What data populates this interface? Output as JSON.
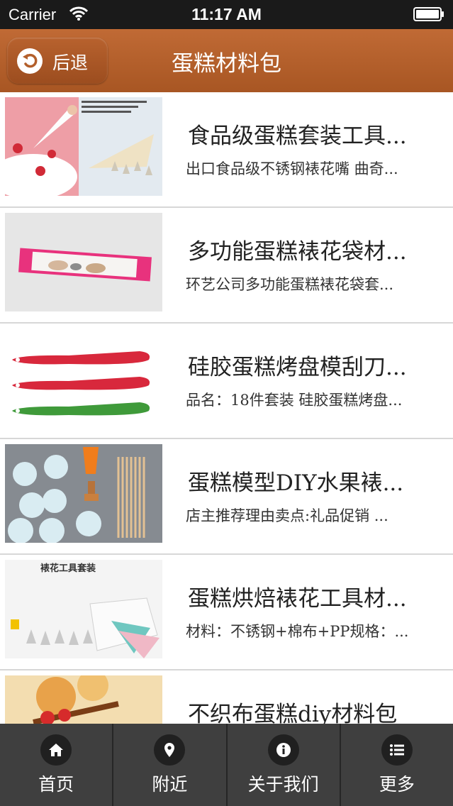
{
  "status": {
    "carrier": "Carrier",
    "time": "11:17 AM"
  },
  "nav": {
    "back_label": "后退",
    "title": "蛋糕材料包"
  },
  "items": [
    {
      "title": "食品级蛋糕套装工具...",
      "subtitle": "出口食品级不锈钢裱花嘴 曲奇..."
    },
    {
      "title": "多功能蛋糕裱花袋材...",
      "subtitle": "环艺公司多功能蛋糕裱花袋套..."
    },
    {
      "title": "硅胶蛋糕烤盘模刮刀...",
      "subtitle": "品名：18件套装 硅胶蛋糕烤盘..."
    },
    {
      "title": "蛋糕模型DIY水果裱...",
      "subtitle": "店主推荐理由卖点:礼品促销 ..."
    },
    {
      "title": "蛋糕烘焙裱花工具材...",
      "subtitle": "材料：不锈钢+棉布+PP规格：..."
    },
    {
      "title": "不织布蛋糕diy材料包",
      "subtitle": ""
    }
  ],
  "thumb_text": {
    "item5": "裱花工具套装"
  },
  "tabs": [
    {
      "label": "首页",
      "icon": "home-icon"
    },
    {
      "label": "附近",
      "icon": "location-pin-icon"
    },
    {
      "label": "关于我们",
      "icon": "info-icon"
    },
    {
      "label": "更多",
      "icon": "list-icon"
    }
  ],
  "colors": {
    "nav_bar": "#b35f2b",
    "tab_bar": "#3f3f3f",
    "status_bar": "#1a1a1a"
  }
}
